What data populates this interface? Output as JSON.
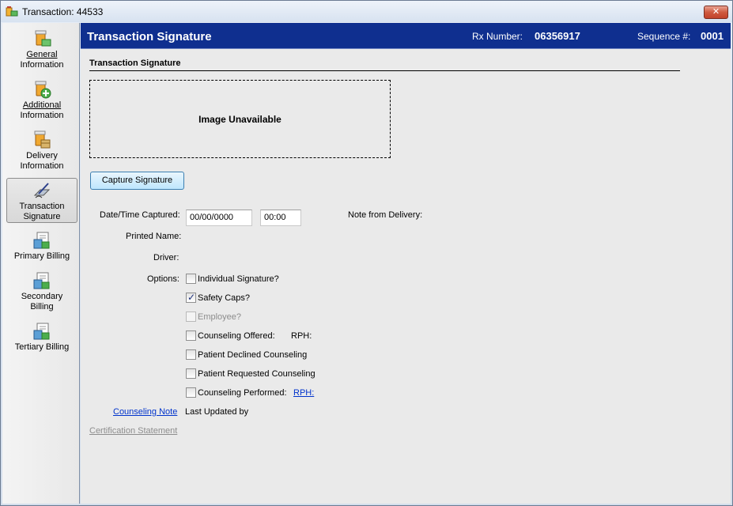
{
  "window": {
    "title": "Transaction: 44533",
    "close_label": "✕"
  },
  "sidebar": {
    "items": [
      {
        "label_line1": "General",
        "label_line2": "Information",
        "icon": "pill-bottle-money-icon"
      },
      {
        "label_line1": "Additional",
        "label_line2": "Information",
        "icon": "pill-bottle-add-icon"
      },
      {
        "label_line1": "Delivery",
        "label_line2": "Information",
        "icon": "delivery-box-icon"
      },
      {
        "label_line1": "Transaction",
        "label_line2": "Signature",
        "icon": "signature-pen-icon",
        "active": true
      },
      {
        "label_line1": "Primary Billing",
        "label_line2": "",
        "icon": "billing-document-icon"
      },
      {
        "label_line1": "Secondary",
        "label_line2": "Billing",
        "icon": "billing-document-icon"
      },
      {
        "label_line1": "Tertiary Billing",
        "label_line2": "",
        "icon": "billing-document-icon"
      }
    ]
  },
  "header": {
    "title": "Transaction Signature",
    "rx_label": "Rx Number:",
    "rx_value": "06356917",
    "seq_label": "Sequence #:",
    "seq_value": "0001",
    "background": "#0f2f8f"
  },
  "section": {
    "title": "Transaction Signature",
    "image_placeholder": "Image Unavailable",
    "capture_button": "Capture Signature"
  },
  "form": {
    "datetime_label": "Date/Time Captured:",
    "date_value": "00/00/0000",
    "time_value": "00:00",
    "note_label": "Note from Delivery:",
    "printed_name_label": "Printed Name:",
    "driver_label": "Driver:",
    "options_label": "Options:",
    "options": {
      "individual_signature": {
        "label": "Individual Signature?",
        "checked": false
      },
      "safety_caps": {
        "label": "Safety Caps?",
        "checked": true
      },
      "employee": {
        "label": "Employee?",
        "checked": false,
        "disabled": true
      },
      "counseling_offered": {
        "label": "Counseling Offered:",
        "checked": false,
        "rph_label": "RPH:"
      },
      "patient_declined": {
        "label": "Patient Declined Counseling",
        "checked": false
      },
      "patient_requested": {
        "label": "Patient Requested Counseling",
        "checked": false
      },
      "counseling_performed": {
        "label": "Counseling Performed:",
        "checked": false,
        "rph_link": "RPH:"
      }
    },
    "counseling_note_link": "Counseling Note",
    "last_updated_label": "Last Updated by",
    "certification_link": "Certification Statement"
  }
}
